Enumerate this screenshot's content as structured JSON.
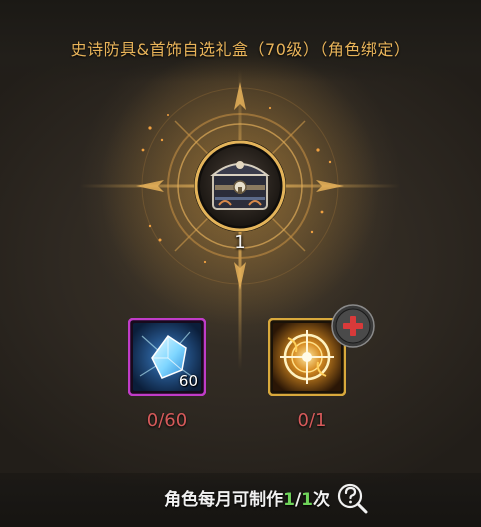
{
  "title": "史诗防具&首饰自选礼盒（70级）（角色绑定）",
  "reward": {
    "icon": "treasure-chest-icon",
    "count": "1"
  },
  "materials": [
    {
      "icon": "blue-crystal-icon",
      "quantity_badge": "60",
      "progress": "0/60",
      "frame_color": "#c03cc8"
    },
    {
      "icon": "golden-sigil-icon",
      "quantity_badge": "",
      "progress": "0/1",
      "frame_color": "#d9a93c"
    }
  ],
  "add_button": {
    "icon": "plus-icon",
    "color": "#d83a3a"
  },
  "footer": {
    "prefix": "角色每月可制作",
    "current": "1",
    "separator": "/",
    "limit": "1",
    "suffix": "次",
    "help_icon": "question-magnifier-icon",
    "highlight_color": "#6fd35a"
  },
  "colors": {
    "title": "#e9b45a",
    "progress_insufficient": "#d65a5a",
    "background": "#2f2922"
  }
}
